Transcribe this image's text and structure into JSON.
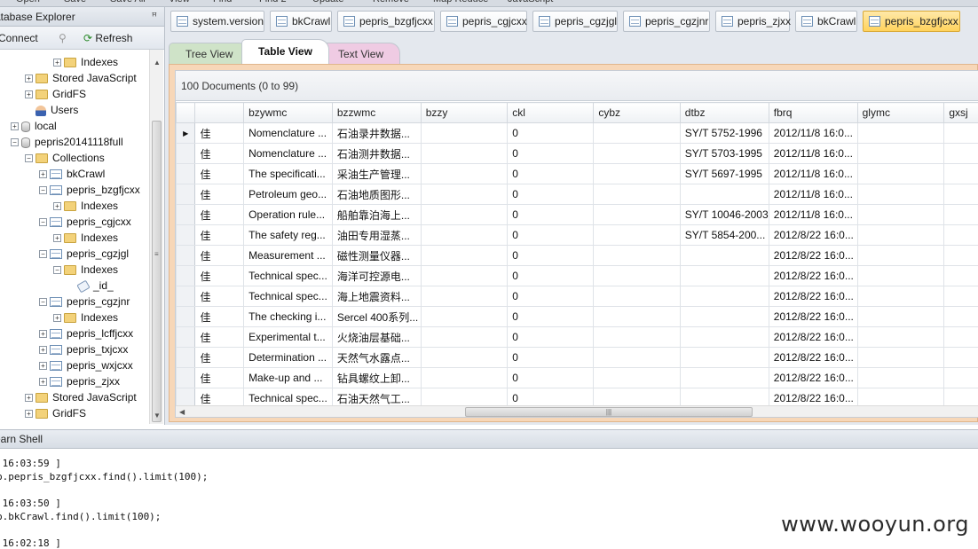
{
  "toolbar_top": [
    "Open",
    "Save",
    "Save All",
    "View",
    "Find",
    "Find 2",
    "Update",
    "Remove",
    "Map Reduce",
    "JavaScript"
  ],
  "explorer": {
    "title": "atabase Explorer",
    "pin": "ꟸ",
    "connect_label": "Connect",
    "refresh_label": "Refresh"
  },
  "tree": [
    {
      "label": "Indexes",
      "icon": "folder",
      "depth": 4,
      "expander": "+"
    },
    {
      "label": "Stored JavaScript",
      "icon": "folder",
      "depth": 2,
      "expander": "+"
    },
    {
      "label": "GridFS",
      "icon": "folder",
      "depth": 2,
      "expander": "+"
    },
    {
      "label": "Users",
      "icon": "user",
      "depth": 2,
      "expander": ""
    },
    {
      "label": "local",
      "icon": "db",
      "depth": 1,
      "expander": "+"
    },
    {
      "label": "pepris20141118full",
      "icon": "db",
      "depth": 1,
      "expander": "−"
    },
    {
      "label": "Collections",
      "icon": "folder",
      "depth": 2,
      "expander": "−"
    },
    {
      "label": "bkCrawl",
      "icon": "table",
      "depth": 3,
      "expander": "+"
    },
    {
      "label": "pepris_bzgfjcxx",
      "icon": "table",
      "depth": 3,
      "expander": "−"
    },
    {
      "label": "Indexes",
      "icon": "folder",
      "depth": 4,
      "expander": "+"
    },
    {
      "label": "pepris_cgjcxx",
      "icon": "table",
      "depth": 3,
      "expander": "−"
    },
    {
      "label": "Indexes",
      "icon": "folder",
      "depth": 4,
      "expander": "+"
    },
    {
      "label": "pepris_cgzjgl",
      "icon": "table",
      "depth": 3,
      "expander": "−"
    },
    {
      "label": "Indexes",
      "icon": "folder",
      "depth": 4,
      "expander": "−"
    },
    {
      "label": "_id_",
      "icon": "key",
      "depth": 5,
      "expander": ""
    },
    {
      "label": "pepris_cgzjnr",
      "icon": "table",
      "depth": 3,
      "expander": "−"
    },
    {
      "label": "Indexes",
      "icon": "folder",
      "depth": 4,
      "expander": "+"
    },
    {
      "label": "pepris_lcffjcxx",
      "icon": "table",
      "depth": 3,
      "expander": "+"
    },
    {
      "label": "pepris_txjcxx",
      "icon": "table",
      "depth": 3,
      "expander": "+"
    },
    {
      "label": "pepris_wxjcxx",
      "icon": "table",
      "depth": 3,
      "expander": "+"
    },
    {
      "label": "pepris_zjxx",
      "icon": "table",
      "depth": 3,
      "expander": "+"
    },
    {
      "label": "Stored JavaScript",
      "icon": "folder",
      "depth": 2,
      "expander": "+"
    },
    {
      "label": "GridFS",
      "icon": "folder",
      "depth": 2,
      "expander": "+"
    }
  ],
  "doc_tabs": [
    {
      "label": "system.version",
      "active": false
    },
    {
      "label": "bkCrawl",
      "active": false
    },
    {
      "label": "pepris_bzgfjcxx",
      "active": false
    },
    {
      "label": "pepris_cgjcxx",
      "active": false
    },
    {
      "label": "pepris_cgzjgl",
      "active": false
    },
    {
      "label": "pepris_cgzjnr",
      "active": false
    },
    {
      "label": "pepris_zjxx",
      "active": false
    },
    {
      "label": "bkCrawl",
      "active": false
    },
    {
      "label": "pepris_bzgfjcxx",
      "active": true
    }
  ],
  "view_tabs": {
    "tree": "Tree View",
    "table": "Table View",
    "text": "Text View"
  },
  "doc_count": "100 Documents (0 to 99)",
  "grid": {
    "columns": [
      "",
      "bzywmc",
      "bzzwmc",
      "bzzy",
      "ckl",
      "cybz",
      "dtbz",
      "fbrq",
      "glymc",
      "gxsj"
    ],
    "rows": [
      [
        "佳",
        "Nomenclature ...",
        "石油录井数据...",
        "",
        "0",
        "",
        "SY/T 5752-1996",
        "2012/11/8 16:0...",
        "",
        ""
      ],
      [
        "佳",
        "Nomenclature ...",
        "石油测井数据...",
        "",
        "0",
        "",
        "SY/T 5703-1995",
        "2012/11/8 16:0...",
        "",
        ""
      ],
      [
        "佳",
        "The specificati...",
        "采油生产管理...",
        "",
        "0",
        "",
        "SY/T 5697-1995",
        "2012/11/8 16:0...",
        "",
        ""
      ],
      [
        "佳",
        "Petroleum geo...",
        "石油地质图形...",
        "",
        "0",
        "",
        "",
        "2012/11/8 16:0...",
        "",
        ""
      ],
      [
        "佳",
        "Operation rule...",
        "船舶靠泊海上...",
        "",
        "0",
        "",
        "SY/T 10046-2003",
        "2012/11/8 16:0...",
        "",
        ""
      ],
      [
        "佳",
        "The safety reg...",
        "油田专用湿蒸...",
        "",
        "0",
        "",
        "SY/T 5854-200...",
        "2012/8/22 16:0...",
        "",
        ""
      ],
      [
        "佳",
        "Measurement ...",
        "磁性测量仪器...",
        "",
        "0",
        "",
        "",
        "2012/8/22 16:0...",
        "",
        ""
      ],
      [
        "佳",
        "Technical spec...",
        "海洋可控源电...",
        "",
        "0",
        "",
        "",
        "2012/8/22 16:0...",
        "",
        ""
      ],
      [
        "佳",
        "Technical spec...",
        "海上地震资料...",
        "",
        "0",
        "",
        "",
        "2012/8/22 16:0...",
        "",
        ""
      ],
      [
        "佳",
        "The checking i...",
        "Sercel 400系列...",
        "",
        "0",
        "",
        "",
        "2012/8/22 16:0...",
        "",
        ""
      ],
      [
        "佳",
        "Experimental t...",
        "火烧油层基础...",
        "",
        "0",
        "",
        "",
        "2012/8/22 16:0...",
        "",
        ""
      ],
      [
        "佳",
        "Determination ...",
        "天然气水露点...",
        "",
        "0",
        "",
        "",
        "2012/8/22 16:0...",
        "",
        ""
      ],
      [
        "佳",
        "Make-up and ...",
        "钻具螺纹上卸...",
        "",
        "0",
        "",
        "",
        "2012/8/22 16:0...",
        "",
        ""
      ],
      [
        "佳",
        "Technical spec...",
        "石油天然气工...",
        "",
        "0",
        "",
        "",
        "2012/8/22 16:0...",
        "",
        ""
      ]
    ]
  },
  "shell": {
    "title": "earn Shell",
    "lines": [
      " 16:03:59 ]",
      "b.pepris_bzgfjcxx.find().limit(100);",
      "",
      " 16:03:50 ]",
      "b.bkCrawl.find().limit(100);",
      "",
      " 16:02:18 ]"
    ]
  },
  "watermark": "www.wooyun.org"
}
